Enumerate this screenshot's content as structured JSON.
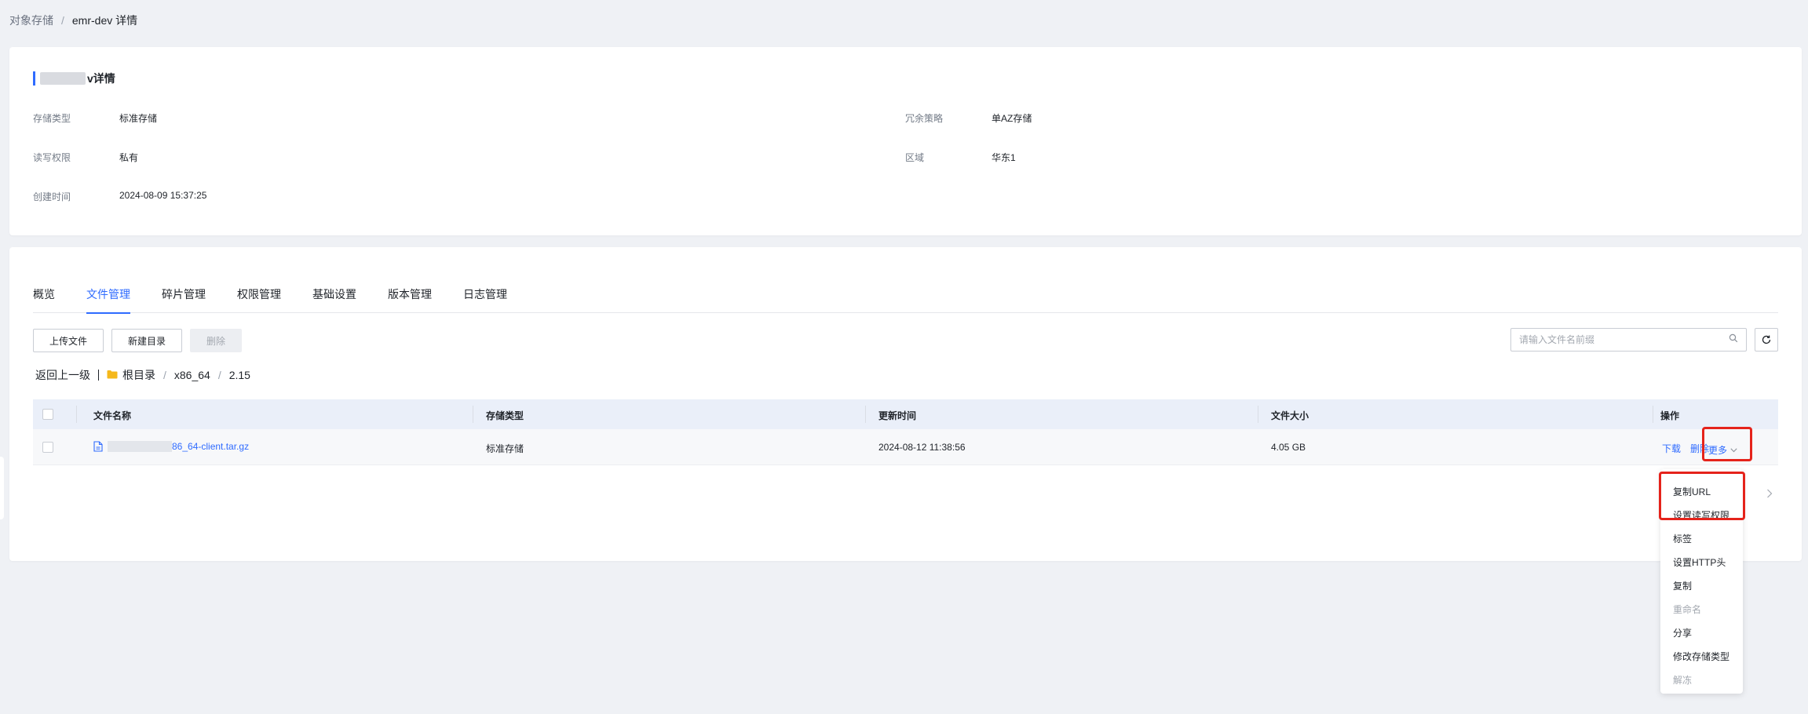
{
  "breadcrumb": {
    "root": "对象存储",
    "separator": "/",
    "current": "emr-dev 详情"
  },
  "info": {
    "title_suffix": "v详情",
    "storage_type_label": "存储类型",
    "storage_type_value": "标准存储",
    "redundancy_label": "冗余策略",
    "redundancy_value": "单AZ存储",
    "rw_permission_label": "读写权限",
    "rw_permission_value": "私有",
    "region_label": "区域",
    "region_value": "华东1",
    "created_label": "创建时间",
    "created_value": "2024-08-09 15:37:25"
  },
  "tabs": [
    {
      "label": "概览"
    },
    {
      "label": "文件管理"
    },
    {
      "label": "碎片管理"
    },
    {
      "label": "权限管理"
    },
    {
      "label": "基础设置"
    },
    {
      "label": "版本管理"
    },
    {
      "label": "日志管理"
    }
  ],
  "toolbar": {
    "upload_label": "上传文件",
    "new_dir_label": "新建目录",
    "delete_label": "删除",
    "search_placeholder": "请输入文件名前缀"
  },
  "path": {
    "back_label": "返回上一级",
    "root_label": "根目录",
    "seg1": "x86_64",
    "seg2": "2.15",
    "separator": "/"
  },
  "table": {
    "headers": [
      "文件名称",
      "存储类型",
      "更新时间",
      "文件大小",
      "操作"
    ],
    "row": {
      "filename_suffix": "86_64-client.tar.gz",
      "storage_type": "标准存储",
      "updated": "2024-08-12 11:38:56",
      "size": "4.05 GB",
      "action_download": "下载",
      "action_delete": "删除",
      "action_more": "更多"
    }
  },
  "more_menu": [
    {
      "label": "复制URL",
      "disabled": false
    },
    {
      "label": "设置读写权限",
      "disabled": false
    },
    {
      "label": "标签",
      "disabled": false
    },
    {
      "label": "设置HTTP头",
      "disabled": false
    },
    {
      "label": "复制",
      "disabled": false
    },
    {
      "label": "重命名",
      "disabled": true
    },
    {
      "label": "分享",
      "disabled": false
    },
    {
      "label": "修改存储类型",
      "disabled": false
    },
    {
      "label": "解冻",
      "disabled": true
    }
  ],
  "colors": {
    "accent": "#2f6bff",
    "highlight": "#e5231b",
    "page_bg": "#eff1f5"
  }
}
